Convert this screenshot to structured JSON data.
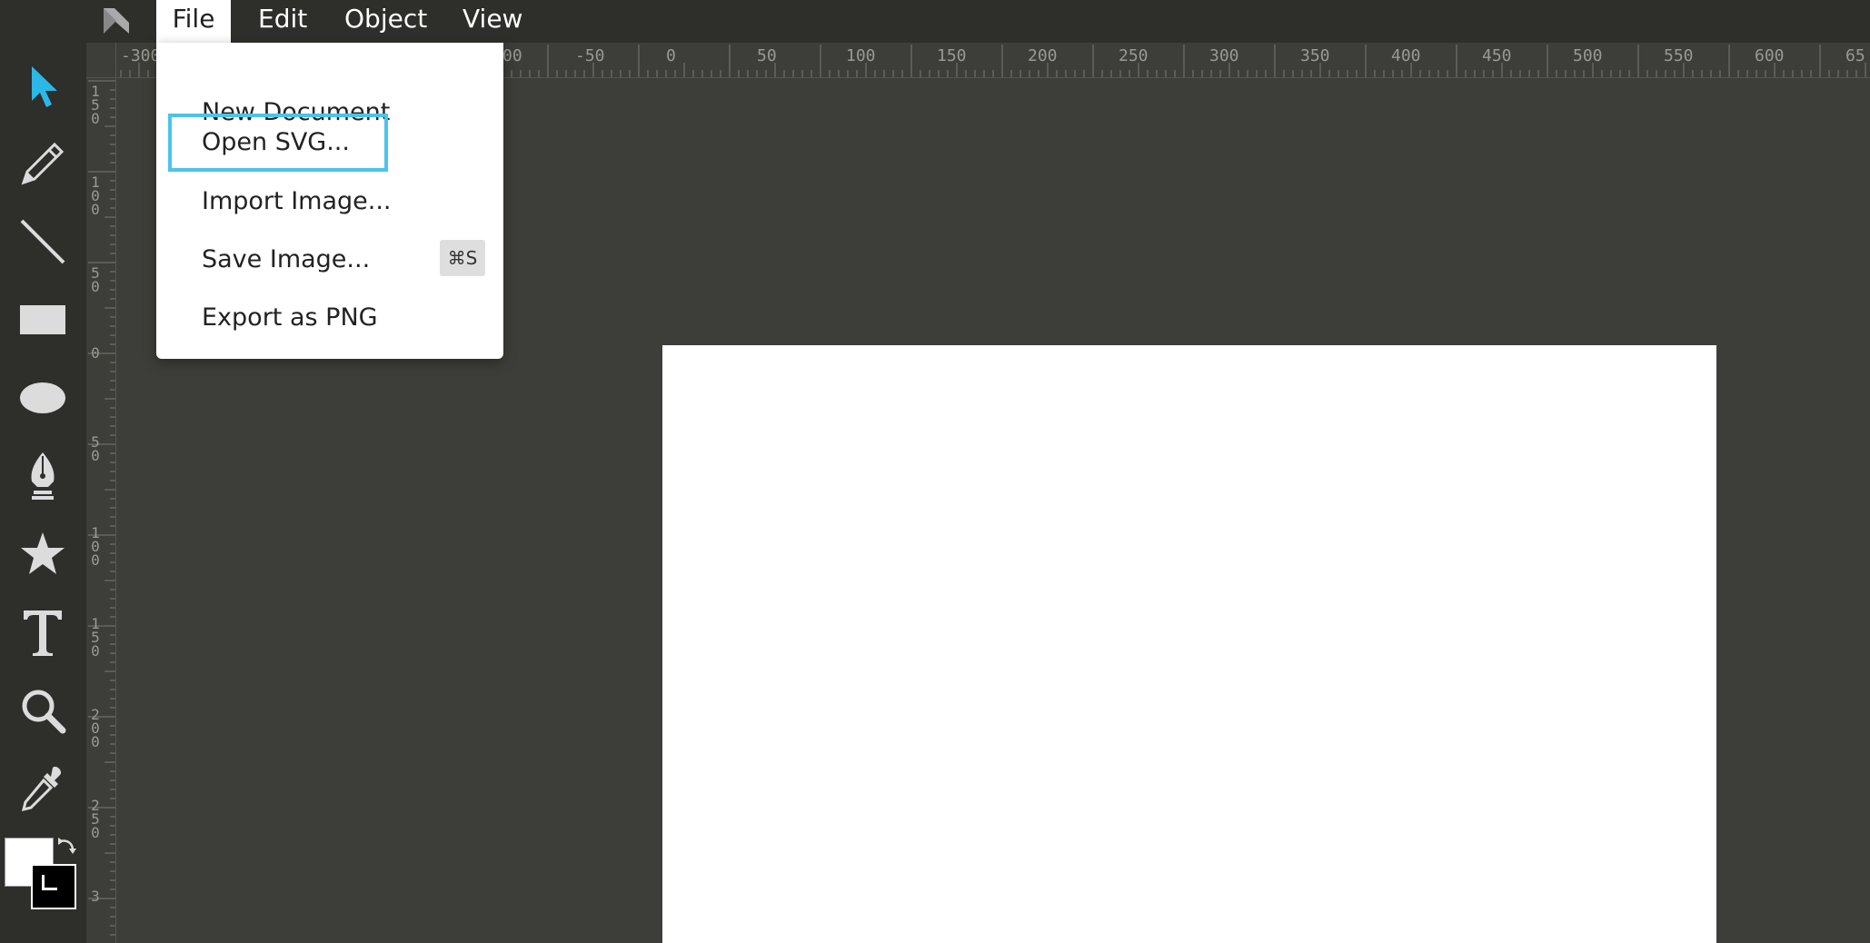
{
  "menubar": {
    "logo_icon": "method-draw-logo-icon",
    "items": [
      {
        "label": "File",
        "active": true
      },
      {
        "label": "Edit"
      },
      {
        "label": "Object"
      },
      {
        "label": "View"
      }
    ]
  },
  "file_menu": {
    "items": [
      {
        "label": "New Document"
      },
      {
        "label": "Open SVG...",
        "highlighted": true
      },
      {
        "label": "Import Image..."
      },
      {
        "label": "Save Image...",
        "shortcut": "⌘S"
      },
      {
        "label": "Export as PNG"
      }
    ]
  },
  "toolbar": {
    "tools": [
      {
        "name": "select-tool",
        "icon": "pointer-arrow-icon",
        "active": true
      },
      {
        "name": "pencil-tool",
        "icon": "pencil-icon"
      },
      {
        "name": "line-tool",
        "icon": "line-icon"
      },
      {
        "name": "rectangle-tool",
        "icon": "rectangle-icon"
      },
      {
        "name": "ellipse-tool",
        "icon": "ellipse-icon"
      },
      {
        "name": "pen-tool",
        "icon": "pen-nib-icon"
      },
      {
        "name": "star-tool",
        "icon": "star-icon"
      },
      {
        "name": "text-tool",
        "icon": "text-T-icon"
      },
      {
        "name": "zoom-tool",
        "icon": "magnifier-icon"
      },
      {
        "name": "eyedropper-tool",
        "icon": "eyedropper-icon"
      }
    ],
    "fill_color": "#ffffff",
    "stroke_color": "#000000",
    "accent_color": "#2bb8e6"
  },
  "ruler_top": {
    "labels": [
      "-300",
      "00",
      "-50",
      "0",
      "50",
      "100",
      "150",
      "200",
      "250",
      "300",
      "350",
      "400",
      "450",
      "500",
      "550",
      "600",
      "65"
    ]
  },
  "ruler_left": {
    "labels": [
      "150",
      "100",
      "50",
      "0",
      "50",
      "100",
      "150",
      "200",
      "250",
      "3"
    ]
  },
  "colors": {
    "menubar_bg": "#2e2e2b",
    "workspace_bg": "#3d3d39",
    "canvas_bg": "#ffffff",
    "highlight_border": "#4cc3ea"
  }
}
